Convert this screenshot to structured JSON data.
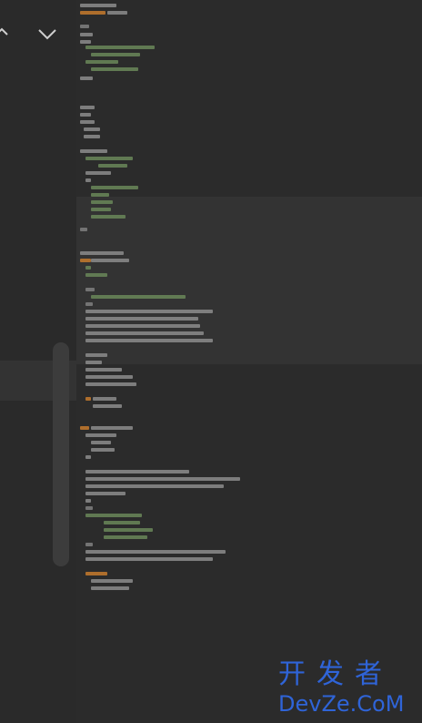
{
  "editor": {
    "left_pane": {
      "nav_icons": [
        "chevron-up-icon",
        "chevron-down-icon"
      ]
    },
    "code_colors": {
      "text": "#8c8c8c",
      "keyword": "#c57a2d",
      "string": "#6a8759",
      "comment": "#808080"
    }
  },
  "watermark": {
    "chinese": "开发者",
    "latin": "DevZe.CoM",
    "color": "#2f64d8"
  }
}
